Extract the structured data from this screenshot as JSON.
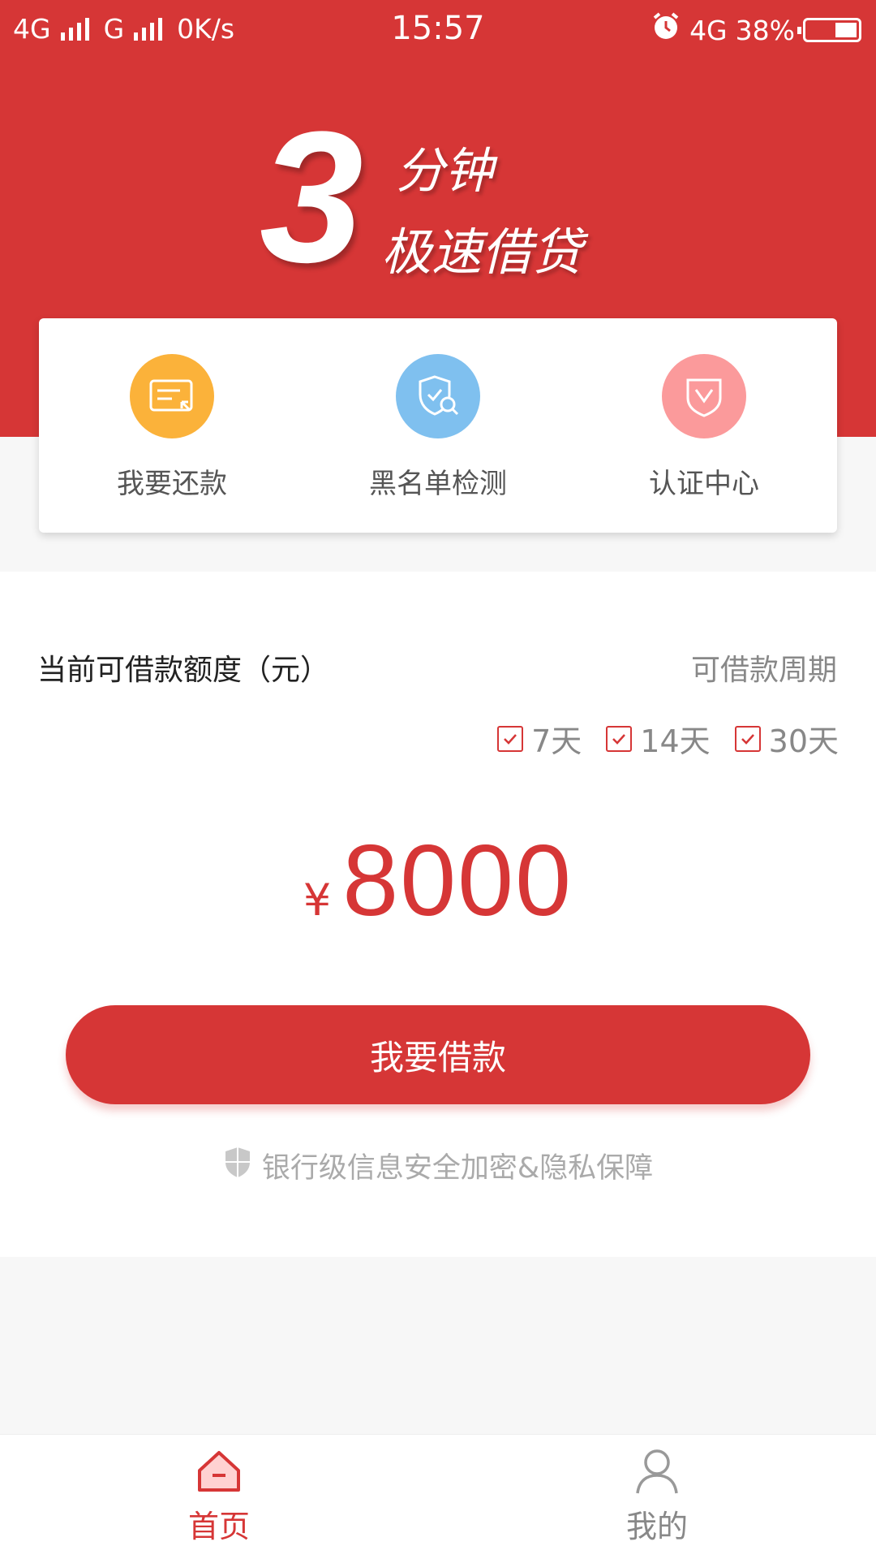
{
  "status_bar": {
    "network1": "4G",
    "network2": "G",
    "speed": "0K/s",
    "time": "15:57",
    "network3": "4G",
    "battery": "38%"
  },
  "hero": {
    "number": "3",
    "line1": "分钟",
    "line2": "极速借贷"
  },
  "quick_actions": [
    {
      "label": "我要还款",
      "icon": "credit-card-icon",
      "color": "#fbb23a"
    },
    {
      "label": "黑名单检测",
      "icon": "shield-search-icon",
      "color": "#7fc0ef"
    },
    {
      "label": "认证中心",
      "icon": "shield-check-icon",
      "color": "#fb9a9b"
    }
  ],
  "loan": {
    "quota_title": "当前可借款额度（元）",
    "period_title": "可借款周期",
    "periods": [
      "7天",
      "14天",
      "30天"
    ],
    "currency": "¥",
    "amount": "8000",
    "button_label": "我要借款",
    "secure_text": "银行级信息安全加密&隐私保障"
  },
  "tabs": [
    {
      "label": "首页",
      "icon": "home-icon",
      "active": true
    },
    {
      "label": "我的",
      "icon": "user-icon",
      "active": false
    }
  ],
  "colors": {
    "brand": "#d63636",
    "text_gray": "#888888"
  }
}
